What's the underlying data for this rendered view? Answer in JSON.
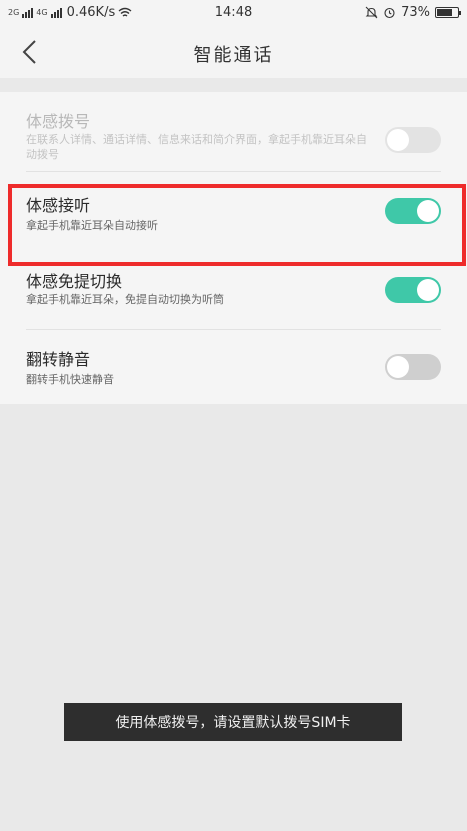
{
  "status_bar": {
    "signal_1": "2G",
    "signal_2": "4G",
    "net_speed": "0.46K/s",
    "time": "14:48",
    "battery_text": "73%"
  },
  "header": {
    "title": "智能通话"
  },
  "settings": [
    {
      "title": "体感拨号",
      "subtitle": "在联系人详情、通话详情、信息来话和简介界面，拿起手机靠近耳朵自动拨号",
      "enabled": false,
      "state": "off"
    },
    {
      "title": "体感接听",
      "subtitle": "拿起手机靠近耳朵自动接听",
      "enabled": true,
      "state": "on"
    },
    {
      "title": "体感免提切换",
      "subtitle": "拿起手机靠近耳朵，免提自动切换为听筒",
      "enabled": true,
      "state": "on"
    },
    {
      "title": "翻转静音",
      "subtitle": "翻转手机快速静音",
      "enabled": true,
      "state": "off"
    }
  ],
  "toast": {
    "message": "使用体感拨号，请设置默认拨号SIM卡"
  },
  "colors": {
    "toggle_on": "#3fc8a8",
    "toggle_off": "#cfcfcf",
    "highlight": "#ee2b2b"
  }
}
